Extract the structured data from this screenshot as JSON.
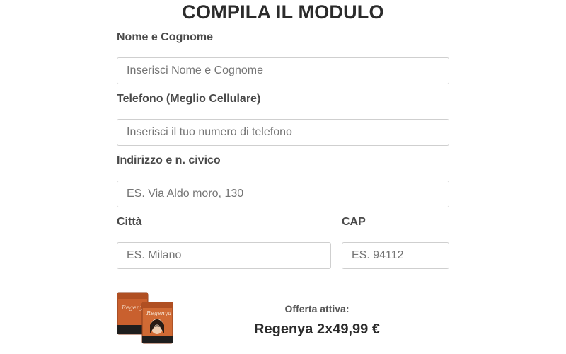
{
  "form": {
    "title": "COMPILA IL MODULO",
    "fields": {
      "name": {
        "label": "Nome e Cognome",
        "placeholder": "Inserisci Nome e Cognome",
        "value": ""
      },
      "phone": {
        "label": "Telefono (Meglio Cellulare)",
        "placeholder": "Inserisci il tuo numero di telefono",
        "value": ""
      },
      "address": {
        "label": "Indirizzo e n. civico",
        "placeholder": "ES. Via Aldo moro, 130",
        "value": ""
      },
      "city": {
        "label": "Città",
        "placeholder": "ES. Milano",
        "value": ""
      },
      "cap": {
        "label": "CAP",
        "placeholder": "ES. 94112",
        "value": ""
      }
    }
  },
  "offer": {
    "label": "Offerta attiva:",
    "value": "Regenya 2x49,99 €",
    "product_brand": "Regenya"
  },
  "colors": {
    "package_orange": "#c9602e",
    "text_dark": "#2b2b2b",
    "label_text": "#4a4a4a",
    "input_border": "#cfcfcf"
  }
}
